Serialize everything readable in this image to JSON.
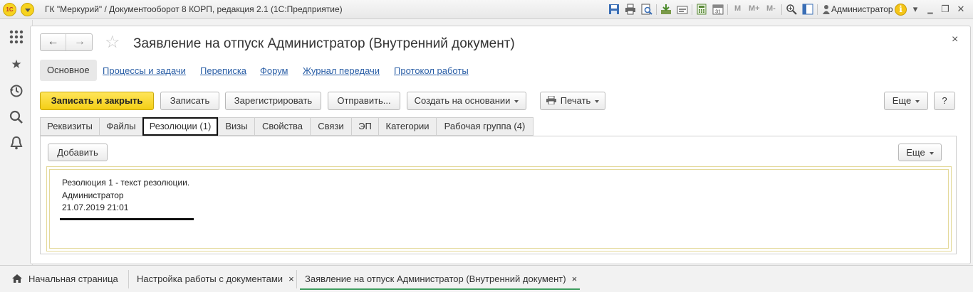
{
  "titlebar": {
    "logo": "1С",
    "app_title": "ГК \"Меркурий\" / Документооборот 8 КОРП, редакция 2.1  (1С:Предприятие)",
    "toolbar_icons": [
      "save-icon",
      "print-icon",
      "preview-icon",
      "download-icon",
      "upload-icon",
      "calculator-icon",
      "calendar-icon"
    ],
    "m_buttons": [
      "M",
      "M+",
      "M-"
    ],
    "user": "Администратор",
    "info": "i"
  },
  "leftpanel": {
    "icons": [
      "apps-grid-icon",
      "star-icon",
      "history-icon",
      "search-icon",
      "bell-icon"
    ]
  },
  "form": {
    "nav_back": "←",
    "nav_forward": "→",
    "title": "Заявление на отпуск Администратор (Внутренний документ)",
    "close": "×",
    "sections": {
      "active": "Основное",
      "links": [
        "Процессы и задачи",
        "Переписка",
        "Форум",
        "Журнал передачи",
        "Протокол работы"
      ]
    },
    "commands": {
      "save_close": "Записать и закрыть",
      "save": "Записать",
      "register": "Зарегистрировать",
      "send": "Отправить...",
      "create_based": "Создать на основании",
      "print": "Печать",
      "more": "Еще",
      "help": "?"
    },
    "tabs": [
      "Реквизиты",
      "Файлы",
      "Резолюции (1)",
      "Визы",
      "Свойства",
      "Связи",
      "ЭП",
      "Категории",
      "Рабочая группа (4)"
    ],
    "active_tab": "Резолюции (1)",
    "panel": {
      "add": "Добавить",
      "more": "Еще",
      "resolution": {
        "text": "Резолюция 1 - текст резолюции.",
        "author": "Администратор",
        "date": "21.07.2019 21:01"
      }
    }
  },
  "window_tabs": {
    "home": "Начальная страница",
    "settings": "Настройка работы с документами",
    "current": "Заявление на отпуск Администратор (Внутренний документ)",
    "close": "×"
  },
  "colors": {
    "primary_button": "#f4cf15",
    "link": "#2a5ea6",
    "active_window_tab": "#3f9d5f",
    "resolution_border": "#e4d99a"
  }
}
